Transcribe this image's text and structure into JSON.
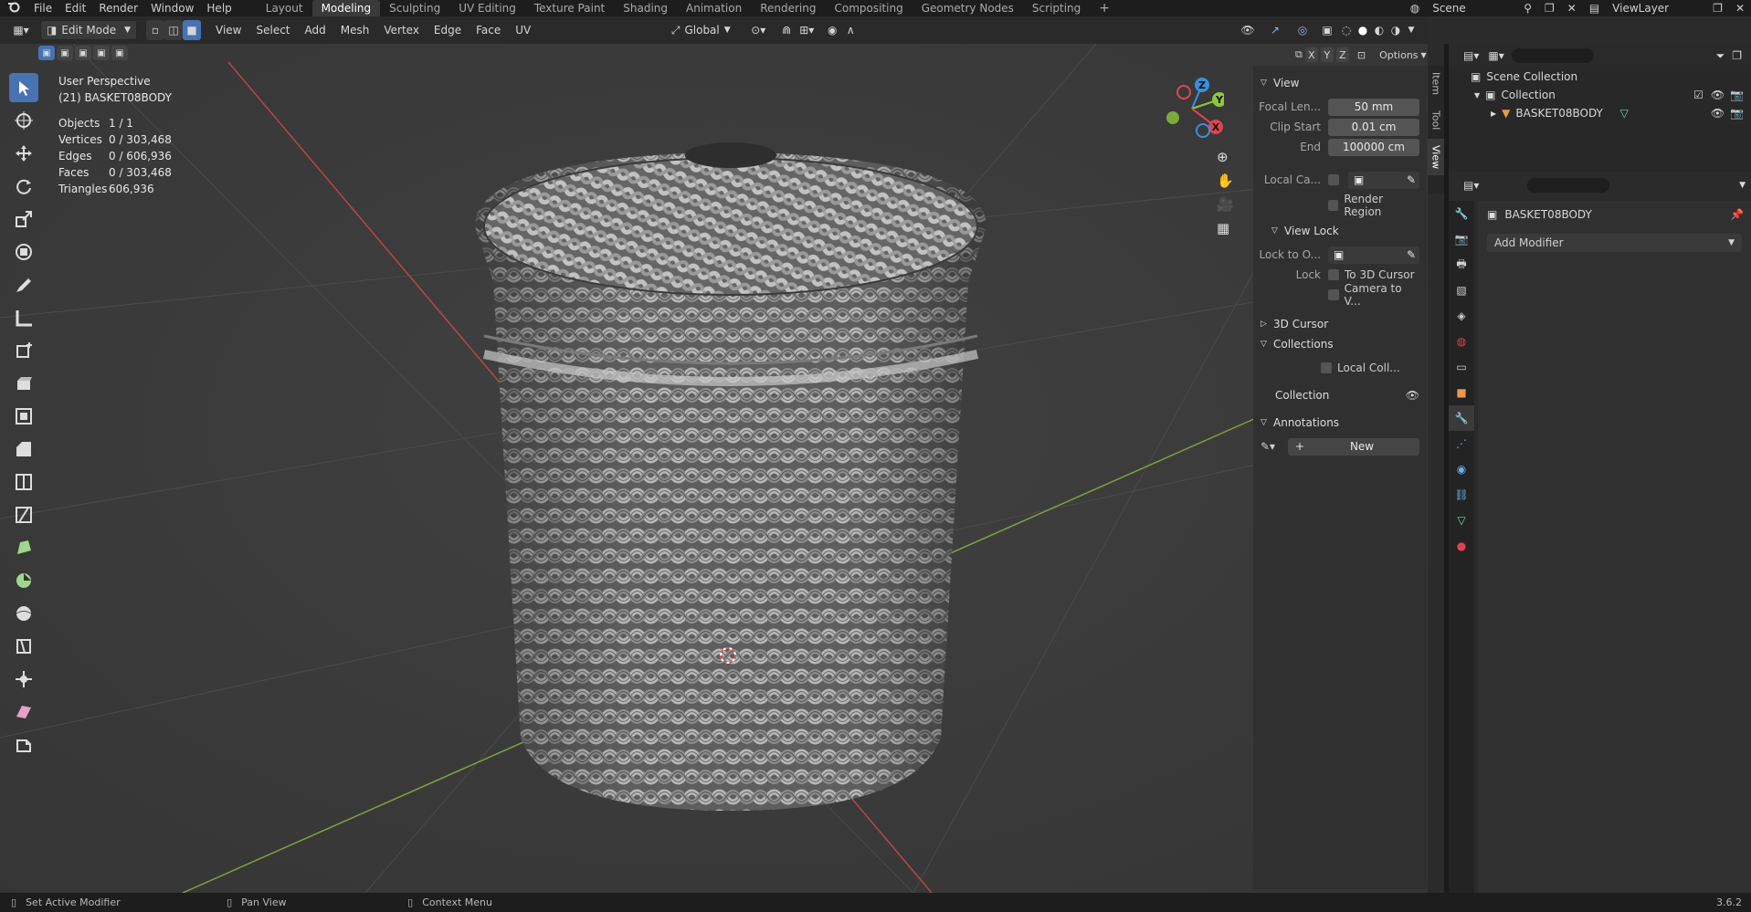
{
  "topbar": {
    "menus": [
      "File",
      "Edit",
      "Render",
      "Window",
      "Help"
    ],
    "workspaces": [
      "Layout",
      "Modeling",
      "Sculpting",
      "UV Editing",
      "Texture Paint",
      "Shading",
      "Animation",
      "Rendering",
      "Compositing",
      "Geometry Nodes",
      "Scripting"
    ],
    "active_workspace": "Modeling",
    "scene_label": "Scene",
    "viewlayer_label": "ViewLayer"
  },
  "header": {
    "mode": "Edit Mode",
    "menus": [
      "View",
      "Select",
      "Add",
      "Mesh",
      "Vertex",
      "Edge",
      "Face",
      "UV"
    ],
    "transform_orientation": "Global",
    "options_label": "Options",
    "axes": [
      "X",
      "Y",
      "Z"
    ]
  },
  "overlay": {
    "perspective": "User Perspective",
    "object_name": "(21) BASKET08BODY",
    "stats": [
      {
        "label": "Objects",
        "value": "1 / 1"
      },
      {
        "label": "Vertices",
        "value": "0 / 303,468"
      },
      {
        "label": "Edges",
        "value": "0 / 606,936"
      },
      {
        "label": "Faces",
        "value": "0 / 303,468"
      },
      {
        "label": "Triangles",
        "value": "606,936"
      }
    ]
  },
  "gizmo": {
    "x": "X",
    "y": "Y",
    "z": "Z"
  },
  "npanel": {
    "view_header": "View",
    "focal_label": "Focal Len...",
    "focal_value": "50 mm",
    "clip_start_label": "Clip Start",
    "clip_start_value": "0.01 cm",
    "end_label": "End",
    "end_value": "100000 cm",
    "local_camera_label": "Local Ca...",
    "render_region_label": "Render Region",
    "view_lock_header": "View Lock",
    "lock_to_label": "Lock to O...",
    "lock_label": "Lock",
    "to_3d_cursor_label": "To 3D Cursor",
    "camera_to_view_label": "Camera to V...",
    "cursor_header": "3D Cursor",
    "collections_header": "Collections",
    "local_coll_label": "Local Coll...",
    "collection_label": "Collection",
    "annotations_header": "Annotations",
    "new_label": "New",
    "tabs": [
      "Item",
      "Tool",
      "View"
    ]
  },
  "outliner": {
    "scene_collection": "Scene Collection",
    "collection": "Collection",
    "object": "BASKET08BODY"
  },
  "properties": {
    "object_name": "BASKET08BODY",
    "add_modifier": "Add Modifier"
  },
  "statusbar": {
    "left": "Set Active Modifier",
    "middle": "Pan View",
    "right": "Context Menu",
    "version": "3.6.2"
  },
  "colors": {
    "accent": "#4772b3",
    "axis_x": "#e0454f",
    "axis_y": "#8cc83a",
    "axis_z": "#3a8fe0"
  }
}
